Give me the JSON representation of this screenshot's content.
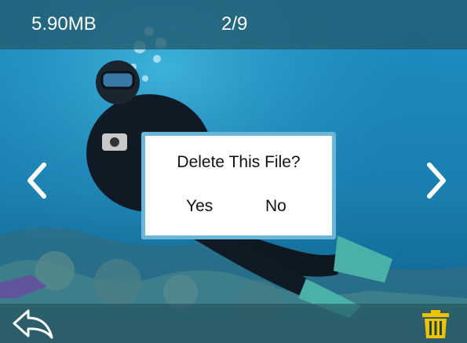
{
  "header": {
    "file_size": "5.90MB",
    "file_index": "2/9"
  },
  "dialog": {
    "title": "Delete This File?",
    "yes_label": "Yes",
    "no_label": "No"
  },
  "icons": {
    "prev": "chevron-left-icon",
    "next": "chevron-right-icon",
    "back": "back-arrow-icon",
    "delete": "trash-icon"
  },
  "colors": {
    "topbar": "#235a6e",
    "dialog_border": "#6bb6d8",
    "trash": "#f2c200",
    "text": "#ffffff"
  }
}
